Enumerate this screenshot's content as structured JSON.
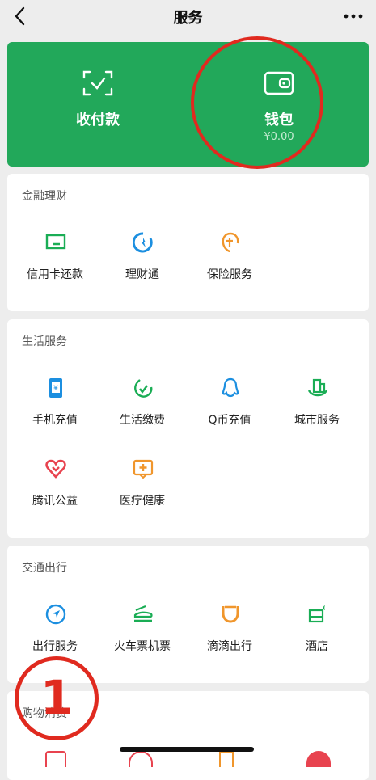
{
  "header": {
    "title": "服务"
  },
  "wallet_panel": {
    "bg_color": "#22a85a",
    "items": [
      {
        "label": "收付款",
        "icon": "scan-check-icon"
      },
      {
        "label": "钱包",
        "sub": "¥0.00",
        "icon": "wallet-icon"
      }
    ]
  },
  "sections": [
    {
      "title": "金融理财",
      "items": [
        {
          "label": "信用卡还款",
          "icon": "credit-card-icon"
        },
        {
          "label": "理财通",
          "icon": "wealth-icon"
        },
        {
          "label": "保险服务",
          "icon": "insurance-icon"
        }
      ]
    },
    {
      "title": "生活服务",
      "items": [
        {
          "label": "手机充值",
          "icon": "phone-topup-icon"
        },
        {
          "label": "生活缴费",
          "icon": "utility-bill-icon"
        },
        {
          "label": "Q币充值",
          "icon": "qq-coin-icon"
        },
        {
          "label": "城市服务",
          "icon": "city-service-icon"
        },
        {
          "label": "腾讯公益",
          "icon": "charity-icon"
        },
        {
          "label": "医疗健康",
          "icon": "medical-icon"
        }
      ]
    },
    {
      "title": "交通出行",
      "items": [
        {
          "label": "出行服务",
          "icon": "navigation-icon"
        },
        {
          "label": "火车票机票",
          "icon": "train-ticket-icon"
        },
        {
          "label": "滴滴出行",
          "icon": "didi-icon"
        },
        {
          "label": "酒店",
          "icon": "hotel-icon"
        }
      ]
    },
    {
      "title": "购物消费",
      "items": []
    }
  ],
  "annotation": {
    "number": "1",
    "color": "#e02a1f"
  }
}
